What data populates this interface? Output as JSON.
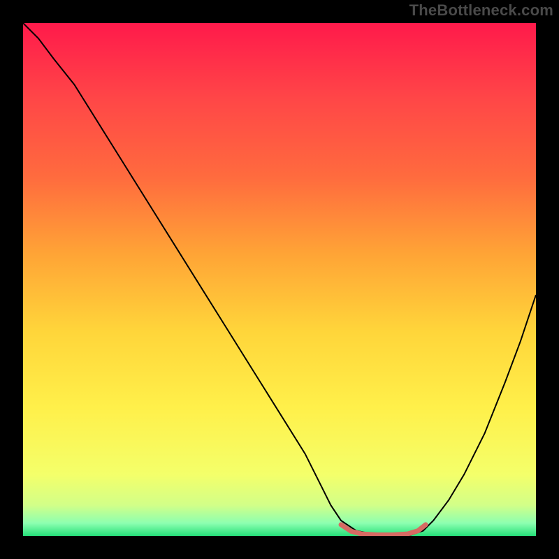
{
  "watermark": "TheBottleneck.com",
  "chart_data": {
    "type": "line",
    "title": "",
    "xlabel": "",
    "ylabel": "",
    "xlim": [
      0,
      100
    ],
    "ylim": [
      0,
      100
    ],
    "grid": false,
    "legend": false,
    "background_gradient": {
      "stops": [
        {
          "offset": 0.0,
          "color": "#ff1a4b"
        },
        {
          "offset": 0.15,
          "color": "#ff4747"
        },
        {
          "offset": 0.3,
          "color": "#ff6b3e"
        },
        {
          "offset": 0.45,
          "color": "#ffa436"
        },
        {
          "offset": 0.6,
          "color": "#ffd53a"
        },
        {
          "offset": 0.75,
          "color": "#fff04a"
        },
        {
          "offset": 0.88,
          "color": "#f4ff6a"
        },
        {
          "offset": 0.94,
          "color": "#d2ff88"
        },
        {
          "offset": 0.975,
          "color": "#8dffb0"
        },
        {
          "offset": 1.0,
          "color": "#26e07a"
        }
      ]
    },
    "series": [
      {
        "name": "bottleneck-curve",
        "stroke": "#000000",
        "stroke_width": 2,
        "x": [
          0,
          3,
          6,
          10,
          15,
          20,
          25,
          30,
          35,
          40,
          45,
          50,
          55,
          58,
          60,
          62,
          65,
          70,
          75,
          78,
          80,
          83,
          86,
          90,
          94,
          97,
          100
        ],
        "y": [
          100,
          97,
          93,
          88,
          80,
          72,
          64,
          56,
          48,
          40,
          32,
          24,
          16,
          10,
          6,
          3,
          1,
          0,
          0,
          1,
          3,
          7,
          12,
          20,
          30,
          38,
          47
        ]
      },
      {
        "name": "optimal-range-marker",
        "stroke": "#d76a63",
        "stroke_width": 7,
        "linecap": "round",
        "x": [
          62,
          64,
          66,
          69,
          72,
          75,
          77,
          78.5
        ],
        "y": [
          2.2,
          0.9,
          0.4,
          0.2,
          0.2,
          0.4,
          1.0,
          2.2
        ]
      }
    ]
  }
}
